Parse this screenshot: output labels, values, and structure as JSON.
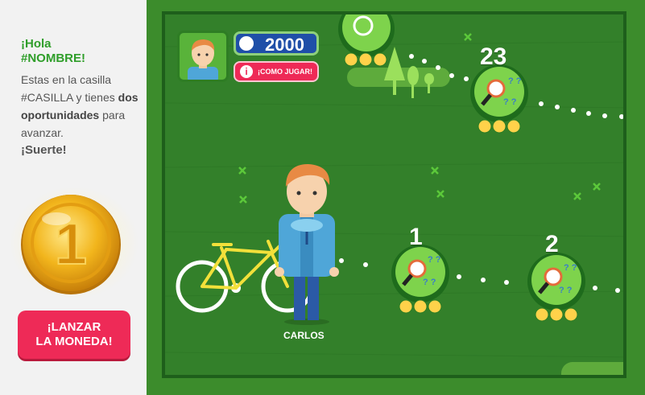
{
  "sidebar": {
    "greeting_line1": "¡Hola",
    "greeting_line2": "#NOMBRE!",
    "message_part1": "Estas en la casilla #CASILLA y tienes",
    "message_bold": "dos oportunidades",
    "message_part2": "para avanzar.",
    "luck": "¡Suerte!",
    "coin_value": "1",
    "button_line1": "¡LANZAR",
    "button_line2": "LA MONEDA!"
  },
  "hud": {
    "score": "2000",
    "howto_label": "¡COMO JUGAR!",
    "howto_icon": "i"
  },
  "board": {
    "squares": [
      {
        "number": "23",
        "stars": 3
      },
      {
        "number": "1",
        "stars": 3
      },
      {
        "number": "2",
        "stars": 3
      }
    ],
    "player_name": "CARLOS"
  },
  "colors": {
    "accent_green": "#2f9e2a",
    "button_pink": "#ee2a57",
    "score_blue": "#1f4fa8",
    "board_green": "#33802a",
    "coin_gold": "#f2b51c"
  }
}
